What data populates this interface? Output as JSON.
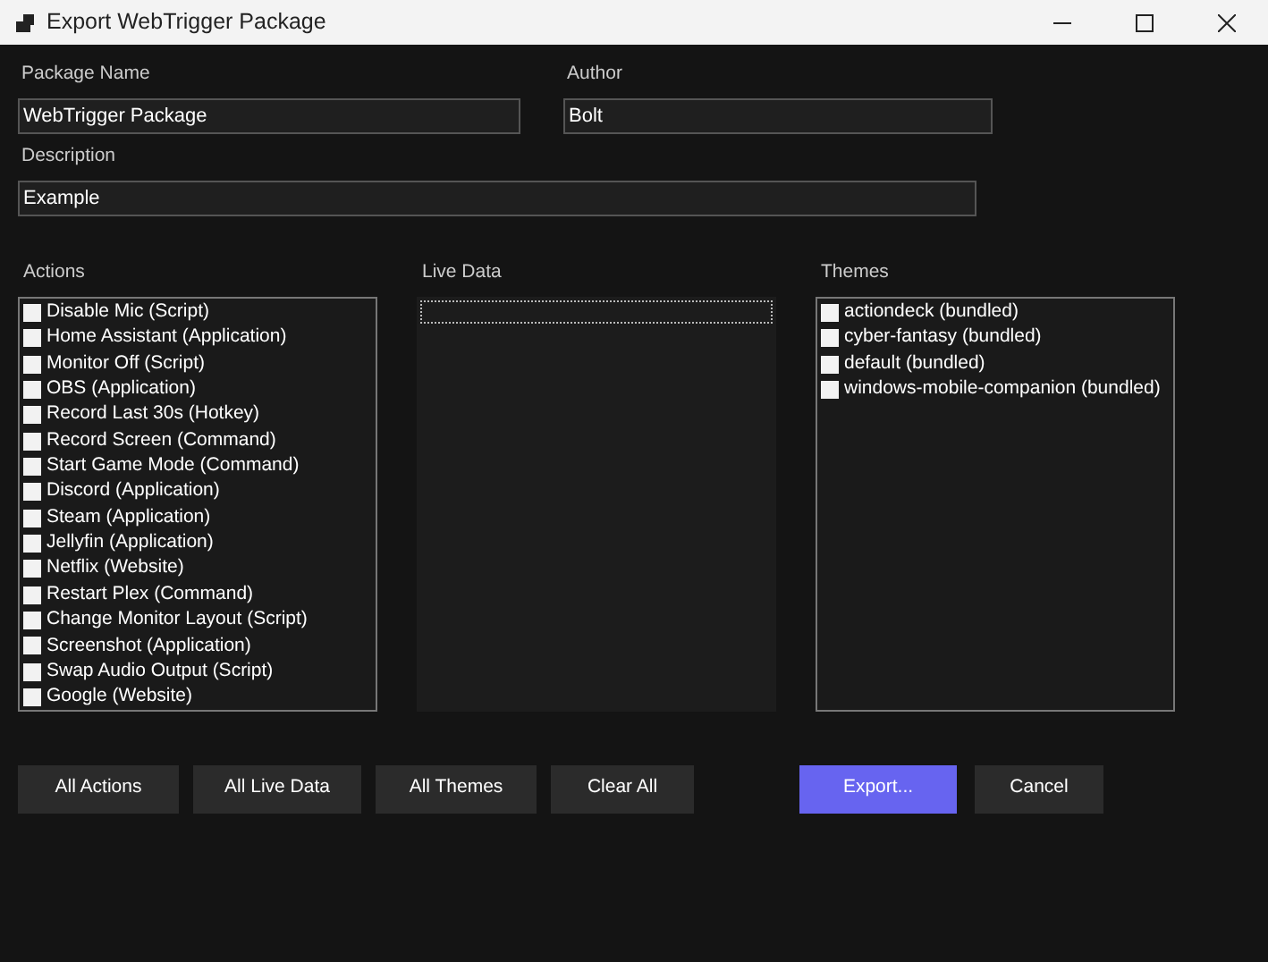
{
  "window": {
    "title": "Export WebTrigger Package"
  },
  "fields": [
    {
      "label": "Package Name",
      "value": "WebTrigger Package"
    },
    {
      "label": "Author",
      "value": "Bolt"
    },
    {
      "label": "Description",
      "value": "Example"
    }
  ],
  "lists": [
    {
      "label": "Actions",
      "items": [
        {
          "label": "Disable Mic (Script)",
          "checked": false
        },
        {
          "label": "Home Assistant (Application)",
          "checked": false
        },
        {
          "label": "Monitor Off (Script)",
          "checked": false
        },
        {
          "label": "OBS (Application)",
          "checked": false
        },
        {
          "label": "Record Last 30s (Hotkey)",
          "checked": false
        },
        {
          "label": "Record Screen (Command)",
          "checked": false
        },
        {
          "label": "Start Game Mode (Command)",
          "checked": false
        },
        {
          "label": "Discord (Application)",
          "checked": false
        },
        {
          "label": "Steam (Application)",
          "checked": false
        },
        {
          "label": "Jellyfin (Application)",
          "checked": false
        },
        {
          "label": "Netflix (Website)",
          "checked": false
        },
        {
          "label": "Restart Plex (Command)",
          "checked": false
        },
        {
          "label": "Change Monitor Layout (Script)",
          "checked": false
        },
        {
          "label": "Screenshot (Application)",
          "checked": false
        },
        {
          "label": "Swap Audio Output (Script)",
          "checked": false
        },
        {
          "label": "Google (Website)",
          "checked": false
        }
      ]
    },
    {
      "label": "Live Data",
      "focused": true
    },
    {
      "label": "Themes",
      "items": [
        {
          "label": "actiondeck (bundled)",
          "checked": false
        },
        {
          "label": "cyber-fantasy (bundled)",
          "checked": false
        },
        {
          "label": "default (bundled)",
          "checked": false
        },
        {
          "label": "windows-mobile-companion (bundled)",
          "checked": false
        }
      ]
    }
  ],
  "buttons": [
    {
      "label": "All Actions",
      "kind": "secondary"
    },
    {
      "label": "All Live Data",
      "kind": "secondary"
    },
    {
      "label": "All Themes",
      "kind": "secondary"
    },
    {
      "label": "Clear All",
      "kind": "secondary"
    },
    {
      "label": "Export...",
      "kind": "primary"
    },
    {
      "label": "Cancel",
      "kind": "secondary"
    }
  ]
}
